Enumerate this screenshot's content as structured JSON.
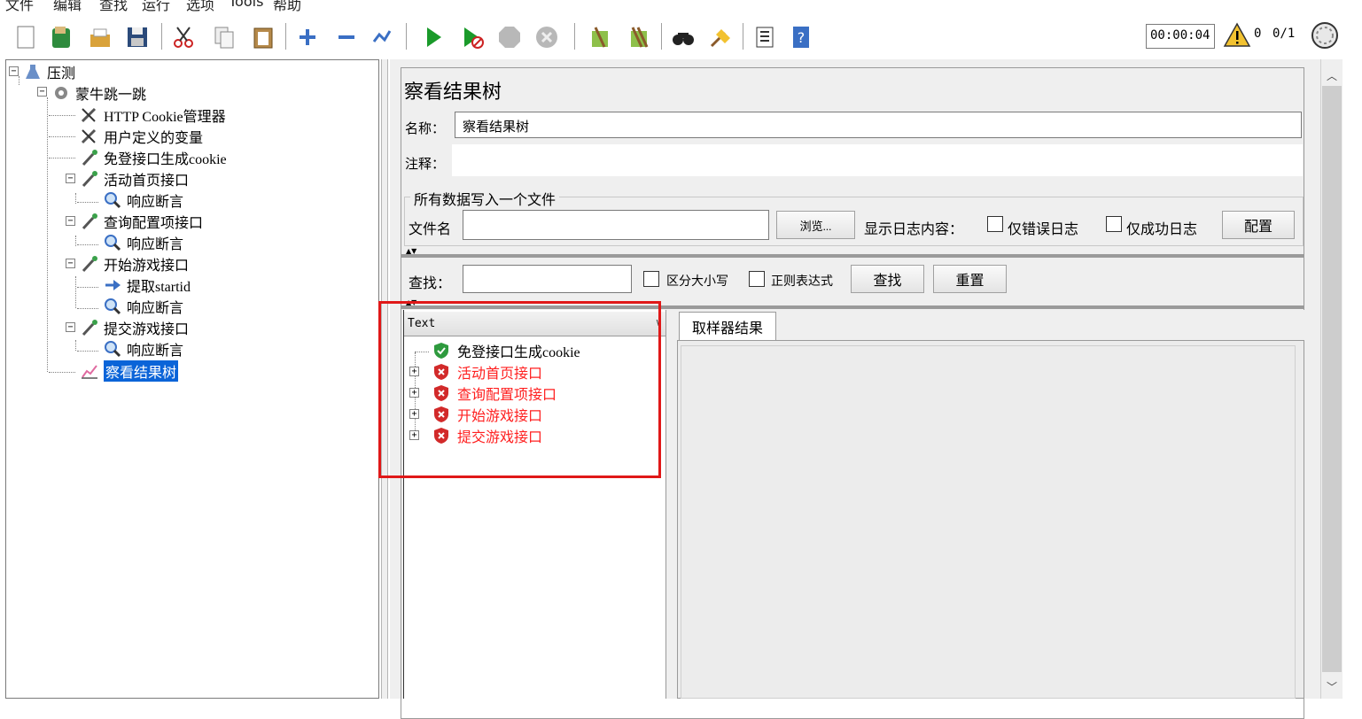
{
  "menu": [
    "文件",
    "编辑",
    "查找",
    "运行",
    "选项",
    "Tools",
    "帮助"
  ],
  "toolbar": {
    "buttons": [
      "new-icon",
      "templates-icon",
      "open-icon",
      "save-icon",
      "cut-icon",
      "copy-icon",
      "paste-icon",
      "expand-icon",
      "collapse-icon",
      "toggle-icon",
      "start-icon",
      "start-no-pause-icon",
      "stop-icon",
      "shutdown-icon",
      "clear-icon",
      "clear-all-icon",
      "search-icon",
      "reset-search-icon",
      "function-helper-icon",
      "help-icon"
    ],
    "timer": "00:00:04",
    "warning_count": "0",
    "threads": "0/1"
  },
  "tree": {
    "root": "压测",
    "thread_group": "蒙牛跳一跳",
    "items": [
      {
        "label": "HTTP Cookie管理器",
        "icon": "tools-icon"
      },
      {
        "label": "用户定义的变量",
        "icon": "tools-icon"
      },
      {
        "label": "免登接口生成cookie",
        "icon": "pipette-icon"
      },
      {
        "label": "活动首页接口",
        "icon": "pipette-icon"
      },
      {
        "label": "响应断言",
        "icon": "magnifier-icon"
      },
      {
        "label": "查询配置项接口",
        "icon": "pipette-icon"
      },
      {
        "label": "响应断言",
        "icon": "magnifier-icon"
      },
      {
        "label": "开始游戏接口",
        "icon": "pipette-icon"
      },
      {
        "label": "提取startid",
        "icon": "arrow-icon"
      },
      {
        "label": "响应断言",
        "icon": "magnifier-icon"
      },
      {
        "label": "提交游戏接口",
        "icon": "pipette-icon"
      },
      {
        "label": "响应断言",
        "icon": "magnifier-icon"
      },
      {
        "label": "察看结果树",
        "icon": "chart-icon"
      }
    ]
  },
  "panel": {
    "title": "察看结果树",
    "name_label": "名称：",
    "name_value": "察看结果树",
    "comment_label": "注释：",
    "file_group_title": "所有数据写入一个文件",
    "file_label": "文件名",
    "browse_label": "浏览...",
    "log_label": "显示日志内容：",
    "errors_only_label": "仅错误日志",
    "success_only_label": "仅成功日志",
    "config_label": "配置",
    "search_label": "查找：",
    "case_label": "区分大小写",
    "regex_label": "正则表达式",
    "find_label": "查找",
    "reset_label": "重置"
  },
  "results": {
    "renderer": "Text",
    "samples": [
      {
        "label": "免登接口生成cookie",
        "status": "success"
      },
      {
        "label": "活动首页接口",
        "status": "fail"
      },
      {
        "label": "查询配置项接口",
        "status": "fail"
      },
      {
        "label": "开始游戏接口",
        "status": "fail"
      },
      {
        "label": "提交游戏接口",
        "status": "fail"
      }
    ],
    "tab_label": "取样器结果"
  },
  "colors": {
    "selected": "#0a64d8",
    "fail": "#ff2020",
    "highlight": "#e01818"
  }
}
